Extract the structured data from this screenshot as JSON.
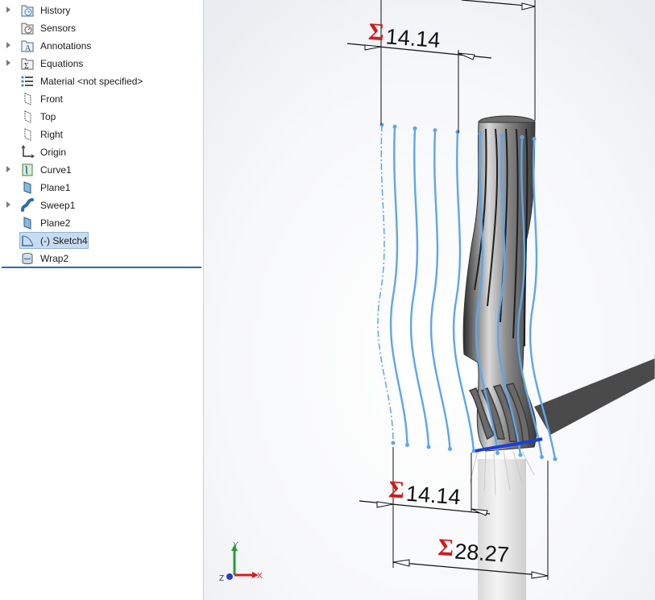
{
  "tree": {
    "items": [
      {
        "label": "History",
        "icon": "history-icon",
        "expandable": true
      },
      {
        "label": "Sensors",
        "icon": "sensors-icon",
        "expandable": false
      },
      {
        "label": "Annotations",
        "icon": "annotations-icon",
        "expandable": true
      },
      {
        "label": "Equations",
        "icon": "equations-icon",
        "expandable": true
      },
      {
        "label": "Material <not specified>",
        "icon": "material-icon",
        "expandable": false
      },
      {
        "label": "Front",
        "icon": "plane-icon",
        "expandable": false
      },
      {
        "label": "Top",
        "icon": "plane-icon",
        "expandable": false
      },
      {
        "label": "Right",
        "icon": "plane-icon",
        "expandable": false
      },
      {
        "label": "Origin",
        "icon": "origin-icon",
        "expandable": false
      },
      {
        "label": "Curve1",
        "icon": "curve-icon",
        "expandable": true
      },
      {
        "label": "Plane1",
        "icon": "ref-plane-icon",
        "expandable": false
      },
      {
        "label": "Sweep1",
        "icon": "sweep-icon",
        "expandable": true
      },
      {
        "label": "Plane2",
        "icon": "ref-plane-icon",
        "expandable": false
      },
      {
        "label": "(-) Sketch4",
        "icon": "sketch-icon",
        "expandable": false,
        "selected": true
      },
      {
        "label": "Wrap2",
        "icon": "wrap-icon",
        "expandable": false
      }
    ]
  },
  "viewport": {
    "dims": {
      "top_dim": "14.14",
      "bottom_inner_dim": "14.14",
      "bottom_outer_dim": "28.27",
      "sigma": "Σ"
    },
    "triad": {
      "x": "X",
      "y": "Y",
      "z": "Z"
    },
    "colors": {
      "sketch": "#5ea6ea",
      "sigma": "#d21a1a",
      "dimension": "#111111"
    }
  }
}
